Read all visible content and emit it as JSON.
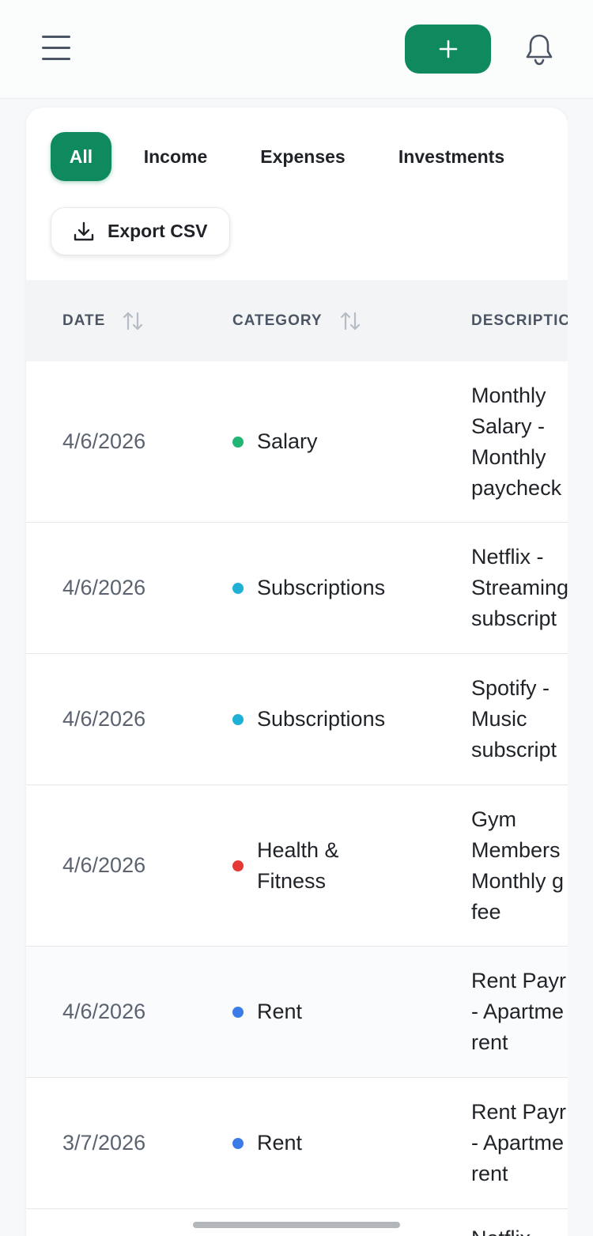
{
  "header": {
    "menu_icon": "hamburger-menu-icon",
    "add_icon": "plus-icon",
    "notifications_icon": "bell-icon",
    "accent_color": "#0f8a5f"
  },
  "filters": {
    "tabs": [
      {
        "label": "All",
        "active": true
      },
      {
        "label": "Income",
        "active": false
      },
      {
        "label": "Expenses",
        "active": false
      },
      {
        "label": "Investments",
        "active": false
      }
    ],
    "export_label": "Export CSV",
    "export_icon": "download-icon"
  },
  "table": {
    "columns": [
      "DATE",
      "CATEGORY",
      "DESCRIPTIC"
    ],
    "rows": [
      {
        "date": "4/6/2026",
        "category": "Salary",
        "category_color": "#22b573",
        "description": "Monthly\nSalary -\nMonthly\npaycheck"
      },
      {
        "date": "4/6/2026",
        "category": "Subscriptions",
        "category_color": "#1fb0d6",
        "description": "Netflix -\nStreaming\nsubscript"
      },
      {
        "date": "4/6/2026",
        "category": "Subscriptions",
        "category_color": "#1fb0d6",
        "description": "Spotify -\nMusic\nsubscript"
      },
      {
        "date": "4/6/2026",
        "category": "Health &\nFitness",
        "category_color": "#e53935",
        "description": "Gym\nMembers\nMonthly g\nfee"
      },
      {
        "date": "4/6/2026",
        "category": "Rent",
        "category_color": "#3b7be8",
        "description": "Rent Payr\n- Apartme\nrent"
      },
      {
        "date": "3/7/2026",
        "category": "Rent",
        "category_color": "#3b7be8",
        "description": "Rent Payr\n- Apartme\nrent"
      },
      {
        "date": "",
        "category": "",
        "category_color": "",
        "description": "Netflix"
      }
    ]
  }
}
